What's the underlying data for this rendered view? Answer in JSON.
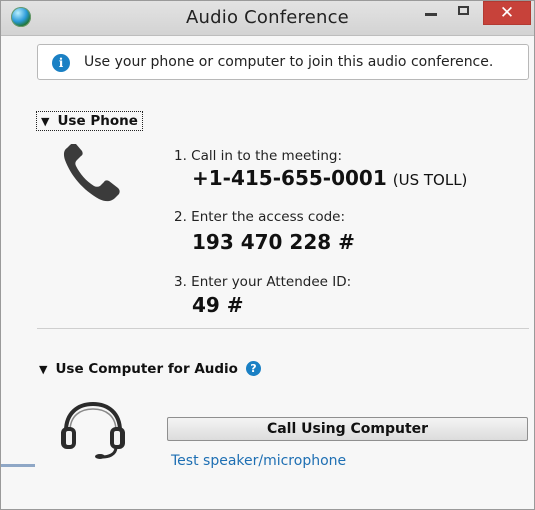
{
  "window": {
    "title": "Audio Conference",
    "close_glyph": "✕"
  },
  "banner": {
    "text": "Use your phone or computer to join this audio conference.",
    "icon": "info-icon"
  },
  "phone_section": {
    "header": "Use Phone",
    "expanded_glyph": "▼",
    "steps": [
      {
        "label": "1. Call in to the meeting:",
        "value": "+1-415-655-0001",
        "suffix": "(US TOLL)"
      },
      {
        "label": "2. Enter the access code:",
        "value": "193 470 228 #"
      },
      {
        "label": "3. Enter your Attendee ID:",
        "value": "49 #"
      }
    ]
  },
  "computer_section": {
    "header": "Use Computer for Audio",
    "expanded_glyph": "▼",
    "help_glyph": "?",
    "call_button": "Call Using Computer",
    "test_link": "Test speaker/microphone"
  },
  "colors": {
    "accent": "#1a80c4",
    "link": "#1e6fb3",
    "close_button": "#c7423a"
  }
}
